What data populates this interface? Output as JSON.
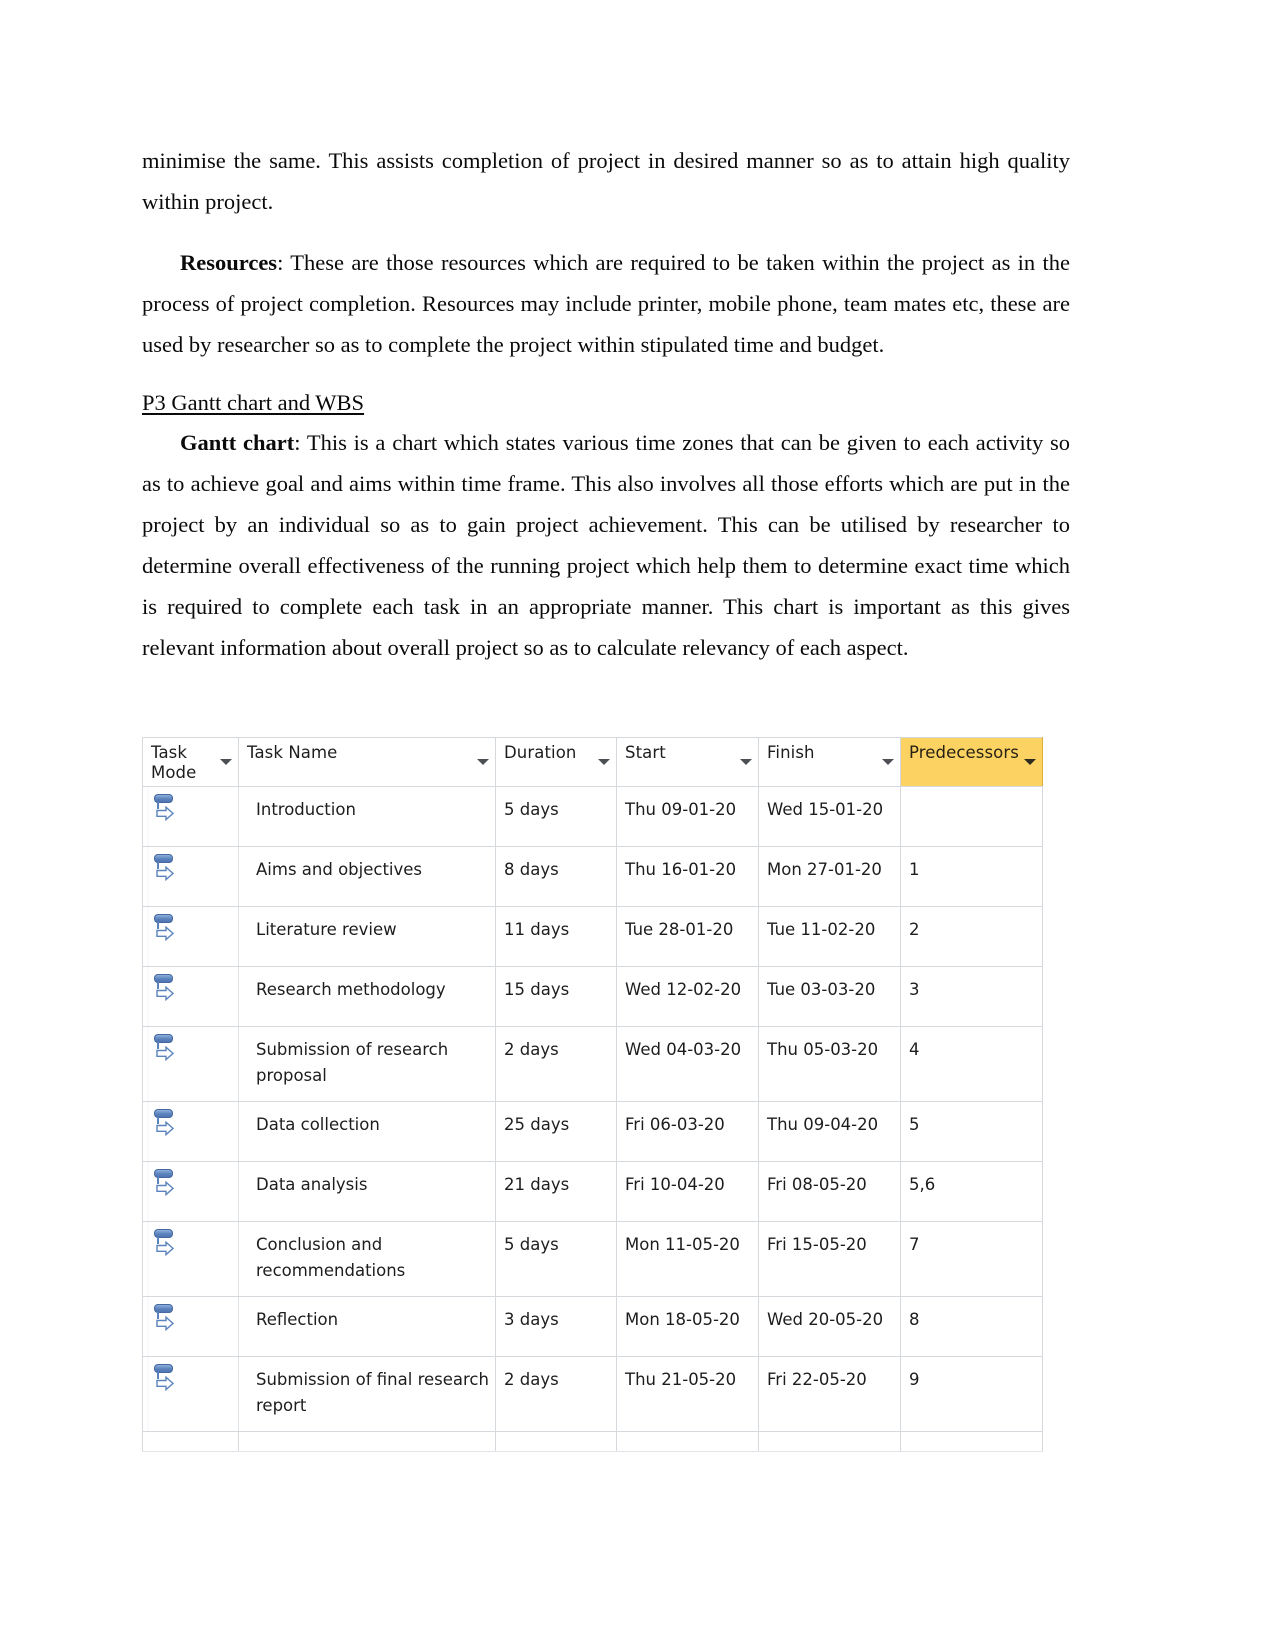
{
  "document": {
    "paragraphs": [
      {
        "id": "para-minimise",
        "text": "minimise the same. This assists completion of project in desired manner so as to attain high quality within project.",
        "indent": false
      }
    ],
    "resources_paragraph": {
      "lead": "Resources",
      "text": ": These are those resources which are required to be taken within the project as in the process of project completion. Resources may include printer, mobile phone, team mates etc, these are used by researcher so as to complete the project within stipulated time and budget."
    },
    "section_heading": "P3 Gantt chart and WBS",
    "gantt_paragraph": {
      "lead": "Gantt chart",
      "text": ": This is a chart which states various time zones that can be given to each activity so as to achieve goal and aims within time frame. This also involves all those efforts which are put in the project by an individual so as to gain project achievement. This can be utilised by researcher to determine overall effectiveness of the running project which help them to determine exact time which is required to complete each task in an appropriate manner. This chart is important as this gives relevant information about overall project so as to calculate relevancy of each aspect."
    }
  },
  "project_table": {
    "columns": [
      {
        "key": "task_mode",
        "label": "Task Mode",
        "has_filter": true,
        "highlighted": false
      },
      {
        "key": "task_name",
        "label": "Task Name",
        "has_filter": true,
        "highlighted": false
      },
      {
        "key": "duration",
        "label": "Duration",
        "has_filter": true,
        "highlighted": false
      },
      {
        "key": "start",
        "label": "Start",
        "has_filter": true,
        "highlighted": false
      },
      {
        "key": "finish",
        "label": "Finish",
        "has_filter": true,
        "highlighted": false
      },
      {
        "key": "predecessors",
        "label": "Predecessors",
        "has_filter": true,
        "highlighted": true
      }
    ],
    "highlight_color": "#fcd362",
    "header_color": "#eceef1",
    "task_mode_icon": "auto-scheduled-icon",
    "rows": [
      {
        "task_name": "Introduction",
        "duration": "5 days",
        "start": "Thu 09-01-20",
        "finish": "Wed 15-01-20",
        "predecessors": ""
      },
      {
        "task_name": "Aims and objectives",
        "duration": "8 days",
        "start": "Thu 16-01-20",
        "finish": "Mon 27-01-20",
        "predecessors": "1"
      },
      {
        "task_name": "Literature review",
        "duration": "11 days",
        "start": "Tue 28-01-20",
        "finish": "Tue 11-02-20",
        "predecessors": "2"
      },
      {
        "task_name": "Research methodology",
        "duration": "15 days",
        "start": "Wed 12-02-20",
        "finish": "Tue 03-03-20",
        "predecessors": "3"
      },
      {
        "task_name": "Submission of research proposal",
        "duration": "2 days",
        "start": "Wed 04-03-20",
        "finish": "Thu 05-03-20",
        "predecessors": "4"
      },
      {
        "task_name": "Data collection",
        "duration": "25 days",
        "start": "Fri 06-03-20",
        "finish": "Thu 09-04-20",
        "predecessors": "5"
      },
      {
        "task_name": "Data analysis",
        "duration": "21 days",
        "start": "Fri 10-04-20",
        "finish": "Fri 08-05-20",
        "predecessors": "5,6"
      },
      {
        "task_name": "Conclusion and recommendations",
        "duration": "5 days",
        "start": "Mon 11-05-20",
        "finish": "Fri 15-05-20",
        "predecessors": "7"
      },
      {
        "task_name": "Reflection",
        "duration": "3 days",
        "start": "Mon 18-05-20",
        "finish": "Wed 20-05-20",
        "predecessors": "8"
      },
      {
        "task_name": "Submission of final research report",
        "duration": "2 days",
        "start": "Thu 21-05-20",
        "finish": "Fri 22-05-20",
        "predecessors": "9"
      }
    ]
  }
}
